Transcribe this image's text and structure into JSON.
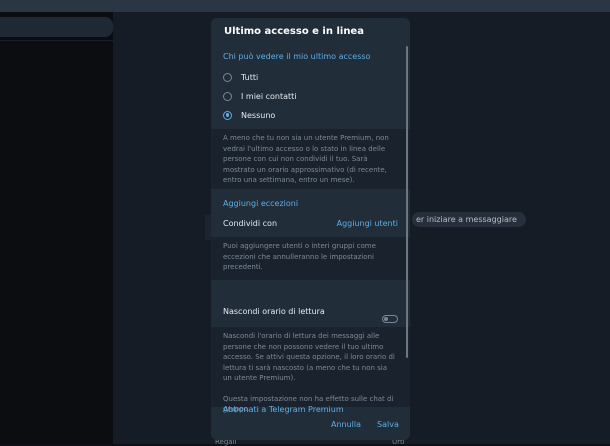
{
  "background": {
    "hint_text": "er iniziare a messaggiare",
    "bottom_left_text": "Regali",
    "bottom_right_text": "Urti"
  },
  "dialog": {
    "title": "Ultimo accesso e in linea",
    "who_can_see": {
      "header": "Chi può vedere il mio ultimo accesso",
      "options": [
        {
          "label": "Tutti",
          "selected": false
        },
        {
          "label": "I miei contatti",
          "selected": false
        },
        {
          "label": "Nessuno",
          "selected": true
        }
      ]
    },
    "info_premium": "A meno che tu non sia un utente Premium, non vedrai l'ultimo accesso o lo stato in linea delle persone con cui non condividi il tuo. Sarà mostrato un orario approssimativo (di recente, entro una settimana, entro un mese).",
    "exceptions": {
      "header": "Aggiungi eccezioni",
      "share_with_label": "Condividi con",
      "add_users_link": "Aggiungi utenti",
      "info": "Puoi aggiungere utenti o interi gruppi come eccezioni che annulleranno le impostazioni precedenti."
    },
    "hide_read_time": {
      "label": "Nascondi orario di lettura",
      "enabled": false,
      "info_1": "Nascondi l'orario di lettura dei messaggi alle persone che non possono vedere il tuo ultimo accesso. Se attivi questa opzione, il loro orario di lettura ti sarà nascosto (a meno che tu non sia un utente Premium).",
      "info_2": "Questa impostazione non ha effetto sulle chat di gruppo."
    },
    "premium_link": "Abbonati a Telegram Premium",
    "cancel_label": "Annulla",
    "save_label": "Salva"
  },
  "colors": {
    "accent": "#5eaee6",
    "dialog_bg": "#222d3a",
    "info_bg": "#1a222d"
  }
}
